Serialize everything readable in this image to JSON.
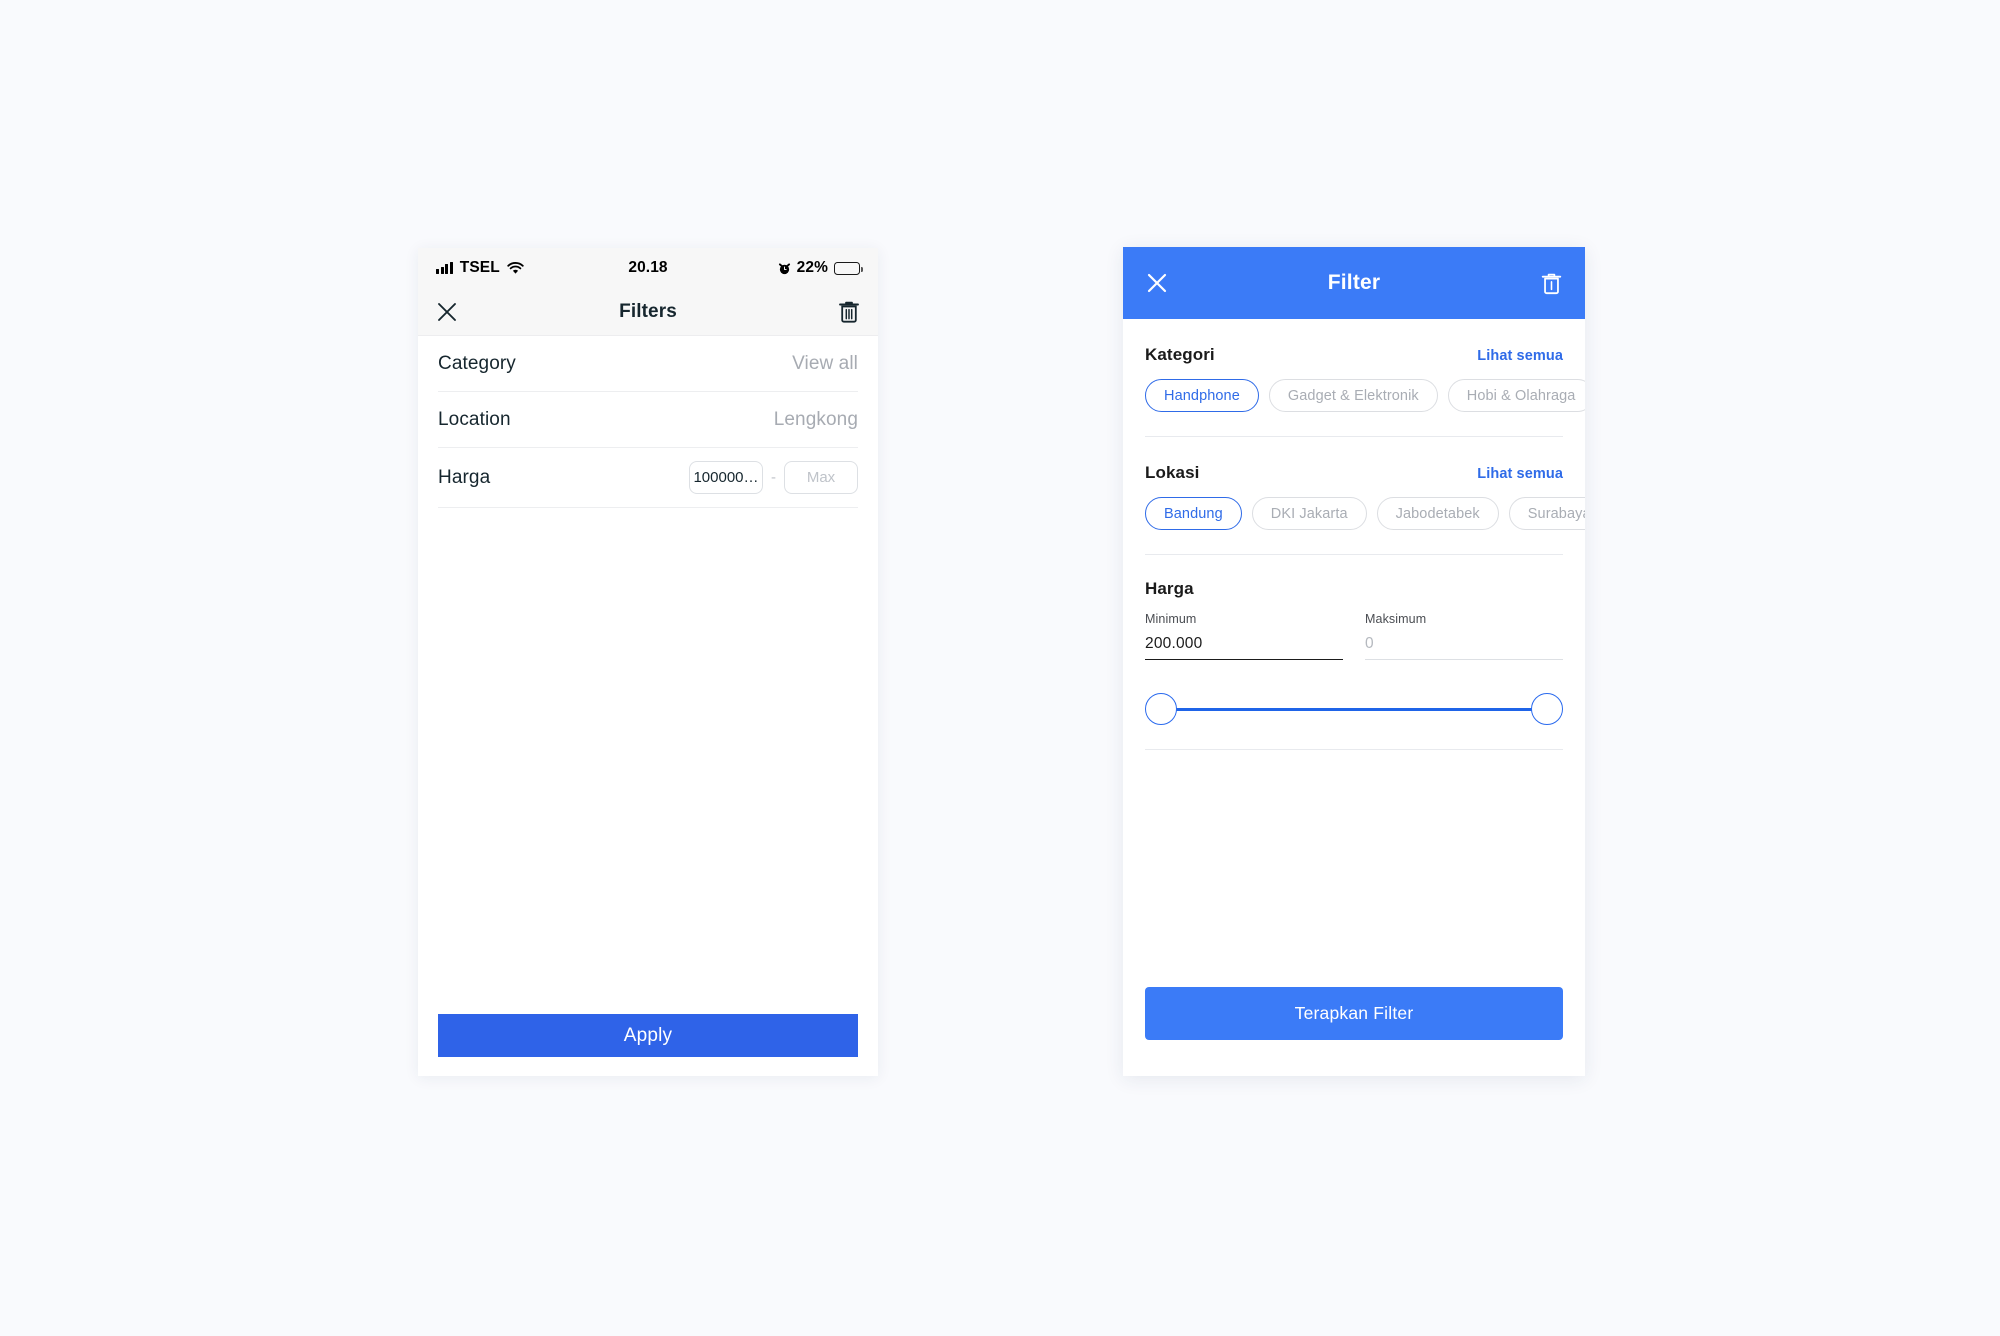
{
  "canvas": {
    "background": "#F9FAFD",
    "accent_blue": "#3B7BF7",
    "apply_blue": "#2F63E8",
    "link_blue": "#2F6BE8",
    "muted_gray": "#A9ADB4"
  },
  "ios_screen": {
    "statusbar": {
      "carrier": "TSEL",
      "time": "20.18",
      "battery_percent": "22%",
      "battery_level": 25,
      "signal_icon": "cellular-signal-icon",
      "wifi_icon": "wifi-icon",
      "alarm_icon": "alarm-clock-icon",
      "battery_icon": "battery-icon"
    },
    "header": {
      "title": "Filters",
      "close_icon": "close-icon",
      "delete_icon": "trash-icon"
    },
    "rows": [
      {
        "label": "Category",
        "value": "View all"
      },
      {
        "label": "Location",
        "value": "Lengkong"
      }
    ],
    "price_row": {
      "label": "Harga",
      "min_value": "100000…",
      "separator": "-",
      "max_placeholder": "Max"
    },
    "apply_label": "Apply"
  },
  "md_screen": {
    "header": {
      "title": "Filter",
      "close_icon": "close-icon",
      "delete_icon": "trash-icon"
    },
    "kategori": {
      "title": "Kategori",
      "see_all": "Lihat semua",
      "chips": [
        {
          "label": "Handphone",
          "selected": true
        },
        {
          "label": "Gadget & Elektronik",
          "selected": false
        },
        {
          "label": "Hobi & Olahraga",
          "selected": false
        }
      ]
    },
    "lokasi": {
      "title": "Lokasi",
      "see_all": "Lihat semua",
      "chips": [
        {
          "label": "Bandung",
          "selected": true
        },
        {
          "label": "DKI Jakarta",
          "selected": false
        },
        {
          "label": "Jabodetabek",
          "selected": false
        },
        {
          "label": "Surabaya",
          "selected": false
        }
      ]
    },
    "harga": {
      "title": "Harga",
      "min_label": "Minimum",
      "min_value": "200.000",
      "max_label": "Maksimum",
      "max_placeholder": "0",
      "slider": {
        "min_handle_pct": 0,
        "max_handle_pct": 100
      }
    },
    "apply_label": "Terapkan Filter"
  }
}
